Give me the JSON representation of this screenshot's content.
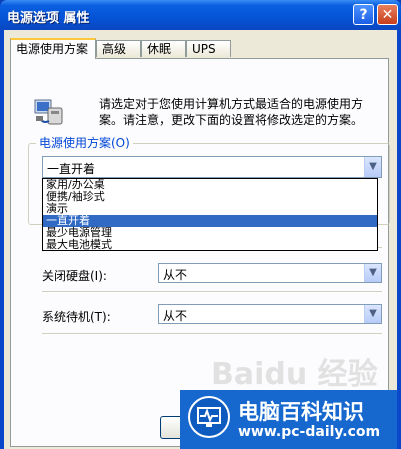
{
  "window": {
    "title": "电源选项 属性",
    "help_label": "?",
    "close_label": "✕"
  },
  "tabs": [
    {
      "label": "电源使用方案",
      "active": true
    },
    {
      "label": "高级",
      "active": false
    },
    {
      "label": "休眠",
      "active": false
    },
    {
      "label": "UPS",
      "active": false
    }
  ],
  "description": "请选定对于您使用计算机方式最适合的电源使用方案。请注意，更改下面的设置将修改选定的方案。",
  "scheme": {
    "group_title": "电源使用方案(O)",
    "selected": "一直开着",
    "options": [
      "家用/办公桌",
      "便携/袖珍式",
      "演示",
      "一直开着",
      "最少电源管理",
      "最大电池模式"
    ],
    "highlighted_index": 3
  },
  "settings": {
    "disk": {
      "label": "关闭硬盘(I):",
      "value": "从不"
    },
    "standby": {
      "label": "系统待机(T):",
      "value": "从不"
    }
  },
  "buttons": {
    "ok_partial": "确"
  },
  "watermark": {
    "title": "电脑百科知识",
    "url": "www.pc-daily.com",
    "baidu": "Baidu 经验"
  }
}
